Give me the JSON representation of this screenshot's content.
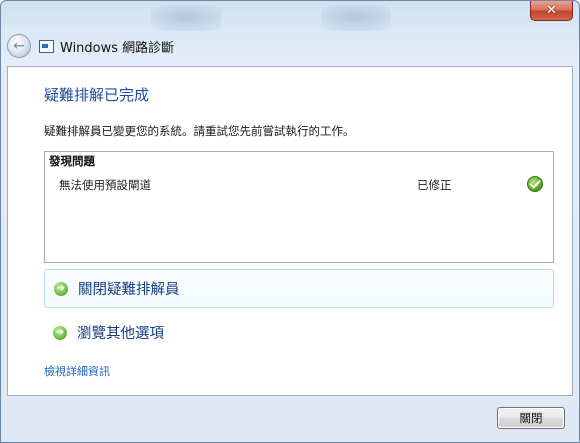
{
  "window": {
    "title": "Windows 網路診斷",
    "close_glyph": "✕"
  },
  "nav": {
    "back_icon": "back-arrow-icon",
    "app_icon": "network-diagnostics-icon"
  },
  "main": {
    "heading": "疑難排解已完成",
    "description": "疑難排解員已變更您的系統。請重試您先前嘗試執行的工作。",
    "problems": {
      "header": "發現問題",
      "rows": [
        {
          "name": "無法使用預設閘道",
          "status": "已修正",
          "icon": "check-icon"
        }
      ]
    },
    "links": [
      {
        "label": "關閉疑難排解員",
        "icon": "green-arrow-icon"
      },
      {
        "label": "瀏覽其他選項",
        "icon": "green-arrow-icon"
      }
    ],
    "details_link": "檢視詳細資訊"
  },
  "footer": {
    "close_button": "關閉"
  },
  "colors": {
    "heading": "#1f4e9e",
    "link": "#1f5fb8",
    "command_link": "#183f82",
    "check": "#57a82a"
  }
}
